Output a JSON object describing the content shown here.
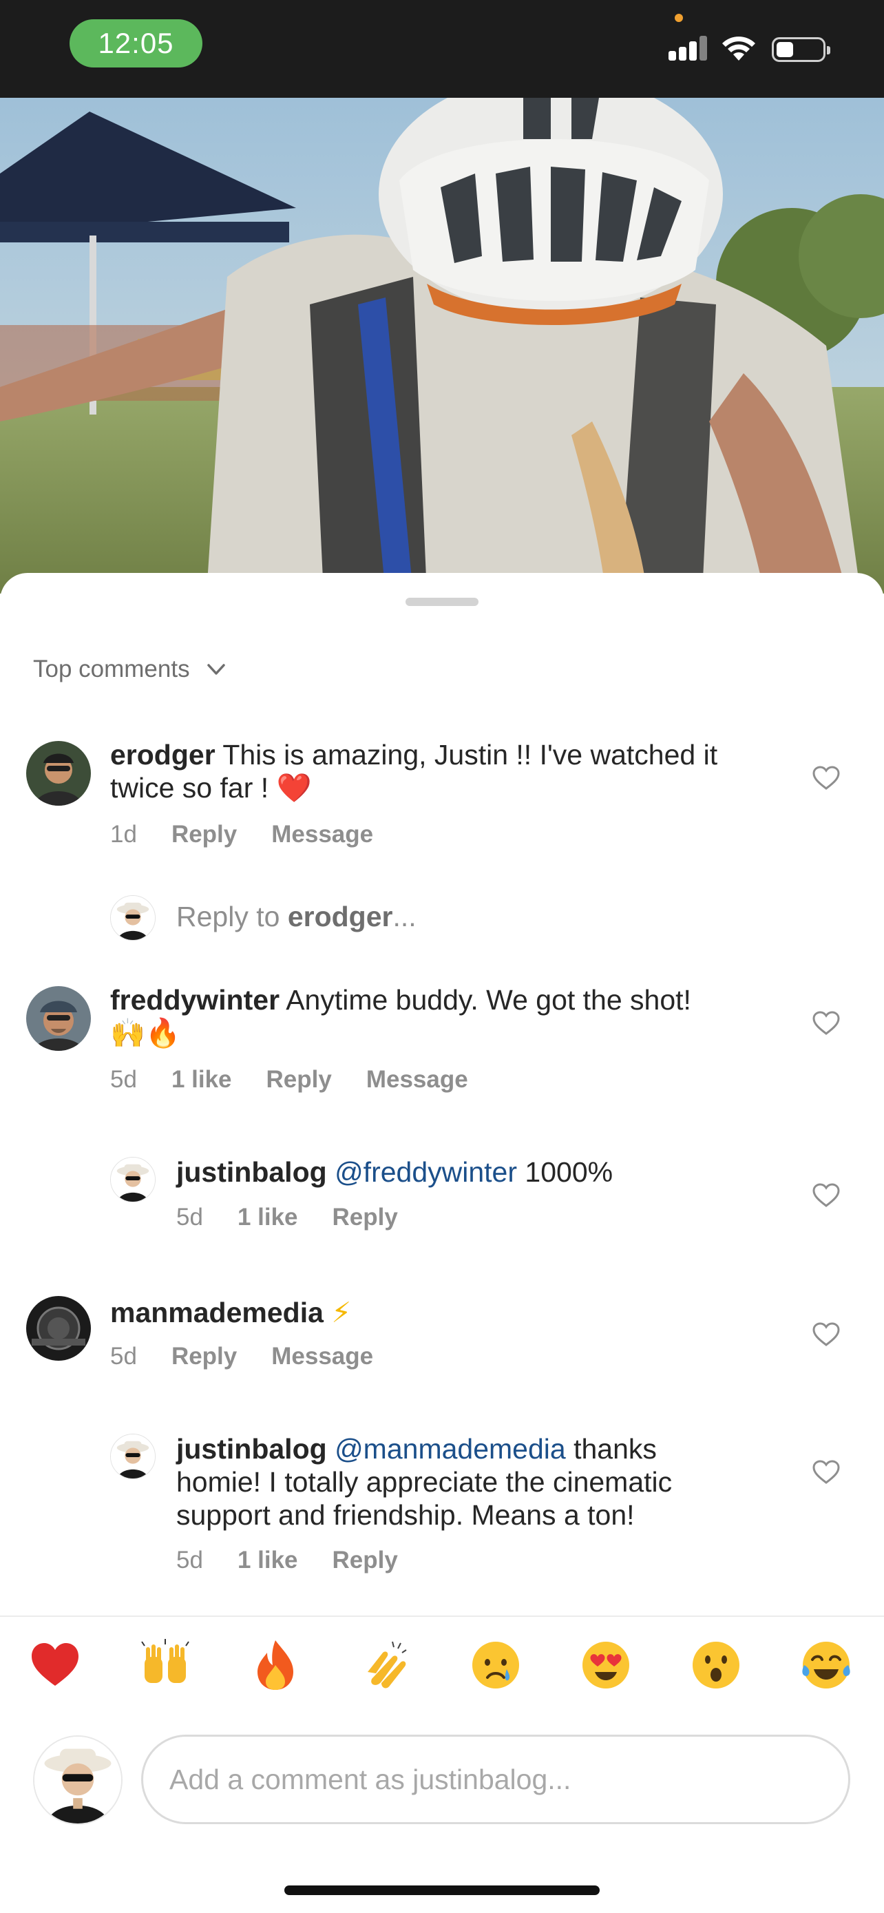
{
  "status_bar": {
    "time": "12:05",
    "clock_color": "#5cb85c"
  },
  "sort": {
    "label": "Top comments",
    "icon": "chevron-down-icon"
  },
  "comments": [
    {
      "username": "erodger",
      "text": "This is amazing, Justin !! I've watched it twice so far !",
      "emoji": "❤️",
      "time": "1d",
      "actions": [
        "Reply",
        "Message"
      ]
    },
    {
      "username": "freddywinter",
      "text": "Anytime buddy.  We got the shot!",
      "emoji": "🙌🔥",
      "time": "5d",
      "likes": "1 like",
      "actions": [
        "Reply",
        "Message"
      ]
    },
    {
      "username": "justinbalog",
      "mention": "@freddywinter",
      "text": "1000%",
      "time": "5d",
      "likes": "1 like",
      "actions": [
        "Reply"
      ]
    },
    {
      "username": "manmademedia",
      "emoji": "⚡",
      "time": "5d",
      "actions": [
        "Reply",
        "Message"
      ]
    },
    {
      "username": "justinbalog",
      "mention": "@manmademedia",
      "text_line1": "thanks",
      "text_line2": "homie! I totally appreciate the cinematic",
      "text_line3": "support and friendship. Means a ton!",
      "time": "5d",
      "likes": "1 like",
      "actions": [
        "Reply"
      ]
    }
  ],
  "reply_prompt": {
    "prefix": "Reply to",
    "username": "erodger",
    "suffix": "..."
  },
  "emoji_bar": [
    "❤️",
    "🙌",
    "🔥",
    "👏",
    "😢",
    "😍",
    "😮",
    "😂"
  ],
  "composer": {
    "placeholder": "Add a comment as justinbalog..."
  },
  "colors": {
    "mention": "#1b4f8a",
    "muted": "#8e8e8e",
    "heart": "#e0245e"
  }
}
